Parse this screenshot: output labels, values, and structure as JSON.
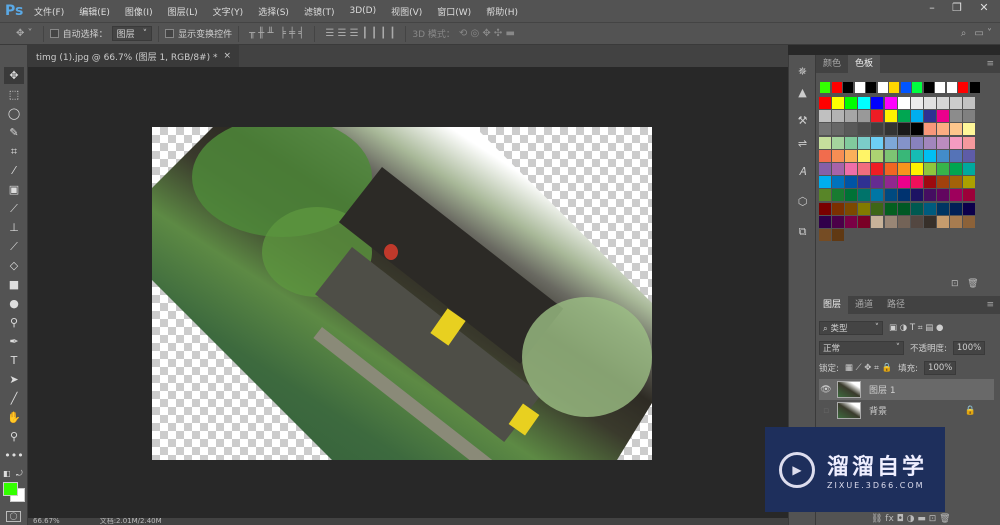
{
  "app": {
    "logo": "Ps"
  },
  "menu": [
    "文件(F)",
    "编辑(E)",
    "图像(I)",
    "图层(L)",
    "文字(Y)",
    "选择(S)",
    "滤镜(T)",
    "3D(D)",
    "视图(V)",
    "窗口(W)",
    "帮助(H)"
  ],
  "window": {
    "minimize": "–",
    "restore": "❐",
    "close": "✕"
  },
  "options": {
    "auto_select_label": "自动选择：",
    "auto_select_value": "图层",
    "show_transform": "显示变换控件",
    "mode_3d": "3D 模式："
  },
  "document": {
    "tab_title": "timg (1).jpg @ 66.7% (图层 1, RGB/8#) *",
    "close": "×"
  },
  "status": {
    "zoom": "66.67%",
    "doc": "文档:2.01M/2.40M"
  },
  "swatches_panel": {
    "tabs": [
      "颜色",
      "色板"
    ],
    "active": 1,
    "recent": [
      "#33ff00",
      "#ff0000",
      "#000000",
      "#ffffff",
      "#000000",
      "#ffffff",
      "#ffd700",
      "#0055ff",
      "#00ff40",
      "#000000",
      "#ffffff",
      "#ffffff",
      "#ff0000",
      "#000000"
    ],
    "grid": [
      "#ff0000",
      "#ffff00",
      "#00ff00",
      "#00ffff",
      "#0000ff",
      "#ff00ff",
      "#ffffff",
      "#ebebeb",
      "#e0e0e0",
      "#d6d6d6",
      "#cccccc",
      "#c2c2c2",
      "#c0c0c0",
      "#b3b3b3",
      "#a6a6a6",
      "#999999",
      "#ed1c24",
      "#fff200",
      "#00a651",
      "#00aeef",
      "#2e3192",
      "#ec008c",
      "#8c8c8c",
      "#808080",
      "#737373",
      "#666666",
      "#595959",
      "#4d4d4d",
      "#404040",
      "#333333",
      "#1a1a1a",
      "#000000",
      "#f7977a",
      "#fbad82",
      "#fdc68c",
      "#fff799",
      "#c6df9c",
      "#a4d49d",
      "#81ca9d",
      "#7bcdc9",
      "#6dcff6",
      "#7da7d8",
      "#8493ca",
      "#8882be",
      "#a286bd",
      "#bc8cbf",
      "#f49bc1",
      "#f5999d",
      "#f16c4d",
      "#f68e54",
      "#fbaf5a",
      "#fff467",
      "#acd372",
      "#7dc473",
      "#39b778",
      "#16bcb4",
      "#00bff3",
      "#438cca",
      "#5573b7",
      "#5e5ca7",
      "#855fa8",
      "#a763a9",
      "#ef6ea8",
      "#f16d7e",
      "#ee1d24",
      "#f16522",
      "#f7941d",
      "#fff100",
      "#8fc63d",
      "#37b44a",
      "#00a650",
      "#00a99e",
      "#00aeef",
      "#0072bc",
      "#0054a5",
      "#2f3192",
      "#652c91",
      "#91278f",
      "#ed008c",
      "#ee105a",
      "#9d0a0f",
      "#a1410d",
      "#a36209",
      "#aba000",
      "#588528",
      "#197b30",
      "#007236",
      "#00736a",
      "#0076a4",
      "#004a80",
      "#003370",
      "#1d1363",
      "#450e61",
      "#62055f",
      "#9e005c",
      "#9d0039",
      "#790000",
      "#7b3000",
      "#7c4900",
      "#827a00",
      "#3e6617",
      "#045f20",
      "#005824",
      "#005951",
      "#005b7e",
      "#003562",
      "#002056",
      "#0c004b",
      "#30004a",
      "#4b0048",
      "#7a0045",
      "#7a0026",
      "#c7b299",
      "#998675",
      "#736357",
      "#534741",
      "#37302a",
      "#c69c6d",
      "#a77c50",
      "#8c6239",
      "#754c24",
      "#603913"
    ]
  },
  "layers_panel": {
    "tabs": [
      "图层",
      "通道",
      "路径"
    ],
    "filter": "类型",
    "blend_mode": "正常",
    "opacity_label": "不透明度:",
    "opacity": "100%",
    "lock_label": "锁定:",
    "fill_label": "填充:",
    "fill": "100%",
    "layers": [
      {
        "name": "图层 1",
        "visible": true,
        "selected": true
      },
      {
        "name": "背景",
        "visible": false,
        "locked": true
      }
    ]
  },
  "colors": {
    "foreground": "#33ff00",
    "background": "#ffffff"
  },
  "watermark": {
    "title": "溜溜自学",
    "url": "ZIXUE.3D66.COM"
  }
}
